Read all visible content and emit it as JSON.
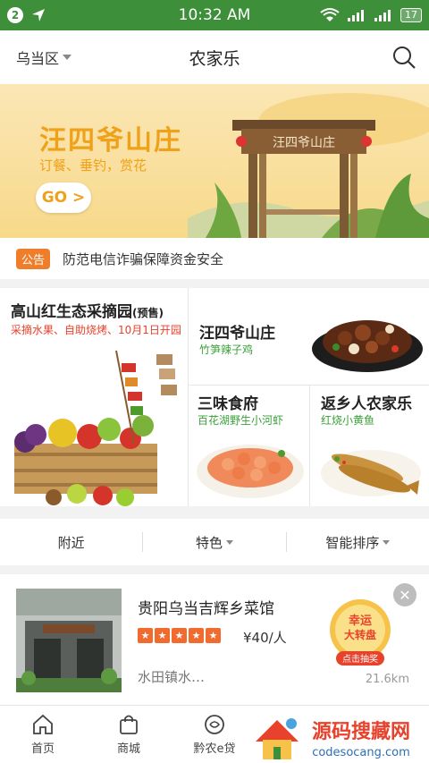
{
  "status_bar": {
    "notification_count": "2",
    "time": "10:32 AM",
    "battery": "17"
  },
  "header": {
    "location": "乌当区",
    "title": "农家乐"
  },
  "banner": {
    "title": "汪四爷山庄",
    "subtitle": "订餐、垂钓，赏花",
    "go_label": "GO >",
    "sign_text": "汪四爷山庄"
  },
  "notice": {
    "tag": "公告",
    "text": "防范电信诈骗保障资金安全"
  },
  "grid": {
    "big": {
      "title": "高山红生态采摘园",
      "badge": "(预售)",
      "subtitle": "采摘水果、自助烧烤、10月1日开园"
    },
    "top_right": {
      "title": "汪四爷山庄",
      "subtitle": "竹笋辣子鸡"
    },
    "bottom_mid": {
      "title": "三味食府",
      "subtitle": "百花湖野生小河虾"
    },
    "bottom_right": {
      "title": "返乡人农家乐",
      "subtitle": "红烧小黄鱼"
    }
  },
  "filters": [
    {
      "label": "附近",
      "has_caret": false
    },
    {
      "label": "特色",
      "has_caret": true
    },
    {
      "label": "智能排序",
      "has_caret": true
    }
  ],
  "listing": {
    "name": "贵阳乌当吉辉乡菜馆",
    "rating": 5,
    "price": "¥40/人",
    "address": "水田镇水…",
    "distance": "21.6km",
    "promo_line1": "幸运",
    "promo_line2": "大转盘",
    "promo_button": "点击抽奖"
  },
  "bottom_nav": [
    {
      "label": "首页",
      "icon": "home-icon"
    },
    {
      "label": "商城",
      "icon": "shopping-bag-icon"
    },
    {
      "label": "黔农e贷",
      "icon": "loan-icon"
    }
  ],
  "watermark": {
    "title": "源码搜藏网",
    "url": "codesocang.com"
  },
  "colors": {
    "brand_green": "#3d8f3a",
    "accent_orange": "#f07d2a",
    "banner_gold": "#f0a11a",
    "red_text": "#e8412c",
    "green_text": "#3aa03a"
  }
}
